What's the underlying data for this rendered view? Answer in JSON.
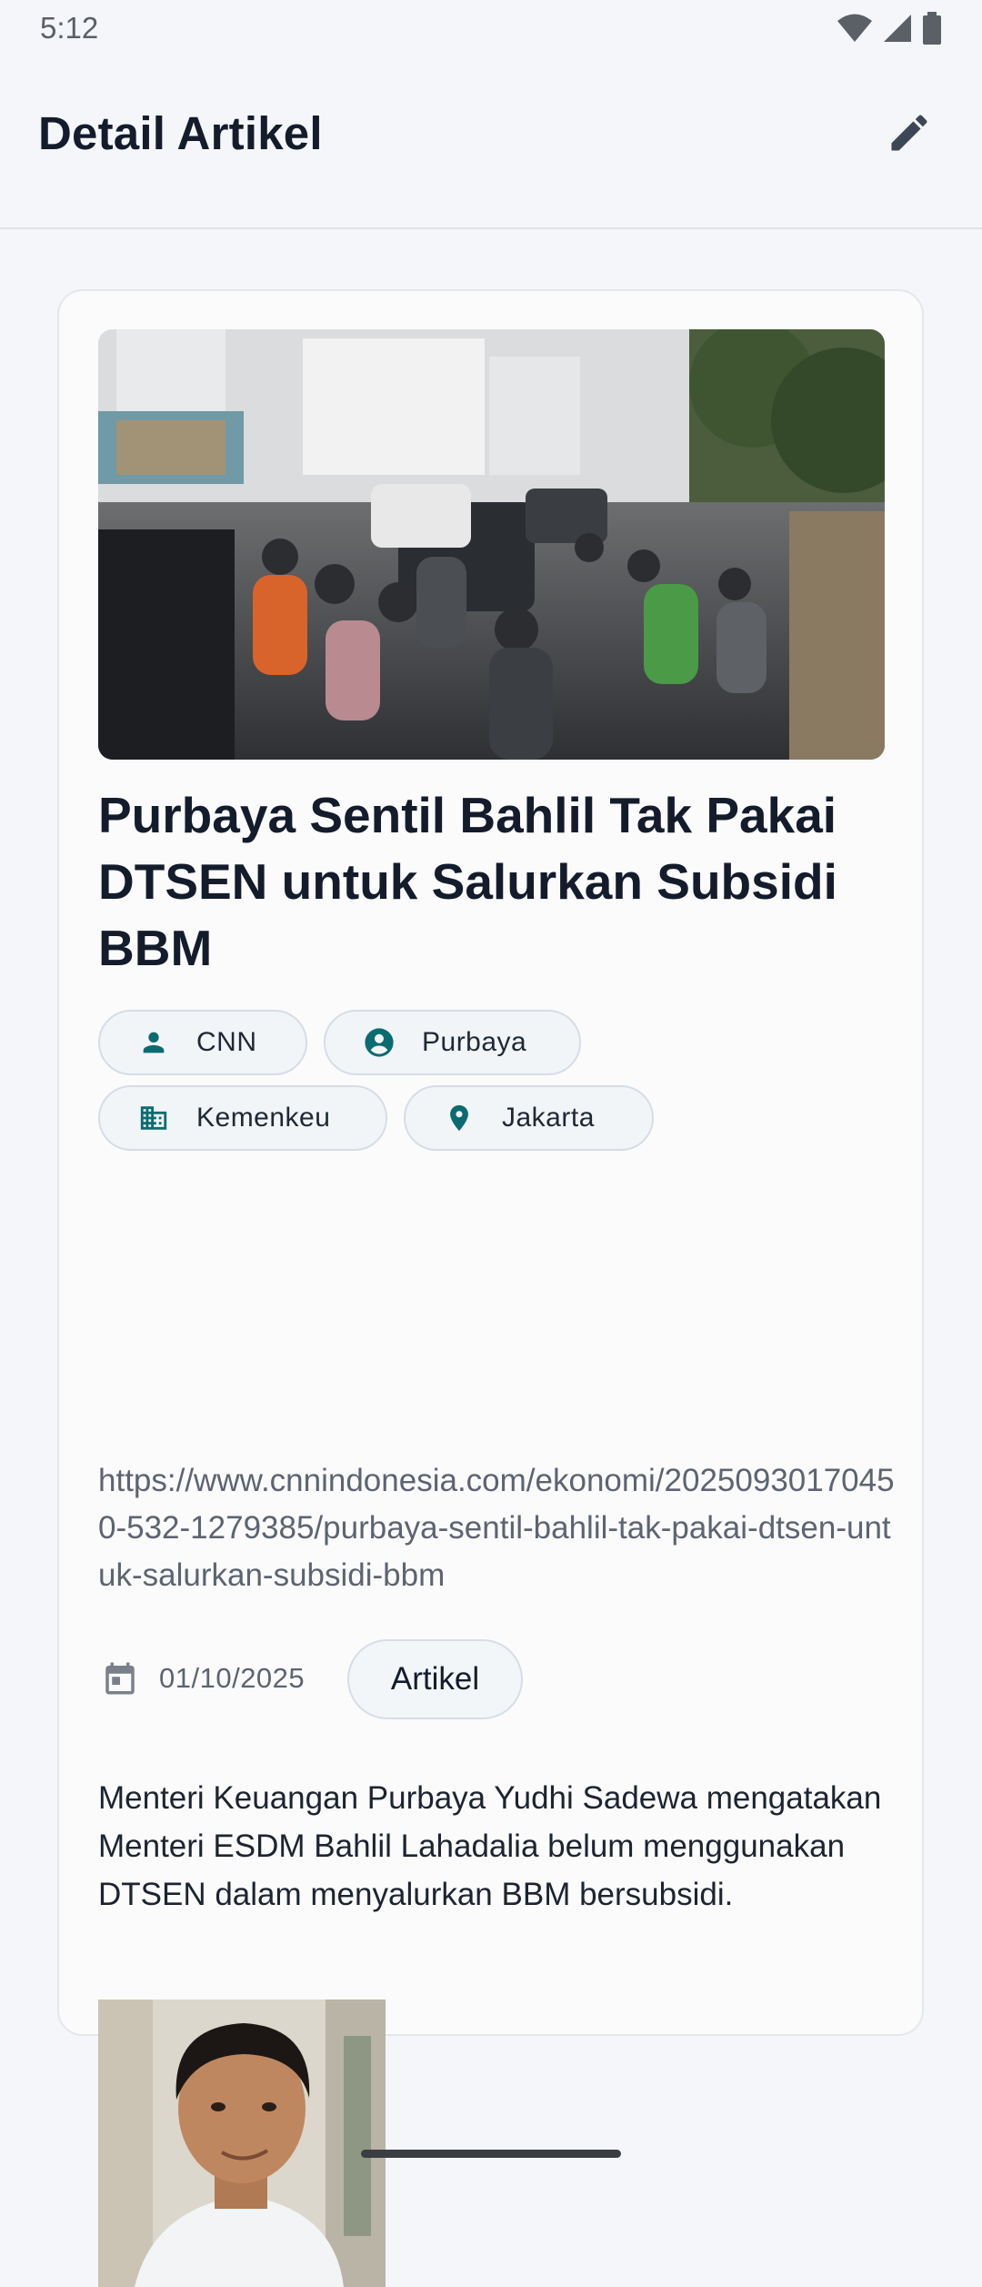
{
  "status_bar": {
    "time": "5:12",
    "icons": [
      "wifi-icon",
      "signal-icon",
      "battery-icon"
    ]
  },
  "app_bar": {
    "title": "Detail Artikel",
    "edit_icon": "pencil-icon"
  },
  "article": {
    "hero_image": "street-traffic-motorcycles-photo",
    "title": "Purbaya Sentil Bahlil Tak Pakai DTSEN untuk Salurkan Subsidi BBM",
    "chips": [
      {
        "icon": "person-icon",
        "label": "CNN"
      },
      {
        "icon": "account-circle-icon",
        "label": "Purbaya"
      },
      {
        "icon": "building-icon",
        "label": "Kemenkeu"
      },
      {
        "icon": "location-pin-icon",
        "label": "Jakarta"
      }
    ],
    "url": "https://www.cnnindonesia.com/ekonomi/20250930170450-532-1279385/purbaya-sentil-bahlil-tak-pakai-dtsen-untuk-salurkan-subsidi-bbm",
    "date": "01/10/2025",
    "type": "Artikel",
    "summary": "Menteri Keuangan Purbaya Yudhi Sadewa mengatakan Menteri ESDM Bahlil Lahadalia belum menggunakan DTSEN dalam menyalurkan BBM bersubsidi.",
    "portrait_image": "person-portrait-photo"
  },
  "colors": {
    "accent": "#0b6b70",
    "title": "#141c2c",
    "muted": "#5d6470",
    "chip_bg": "#f1f5f8"
  }
}
